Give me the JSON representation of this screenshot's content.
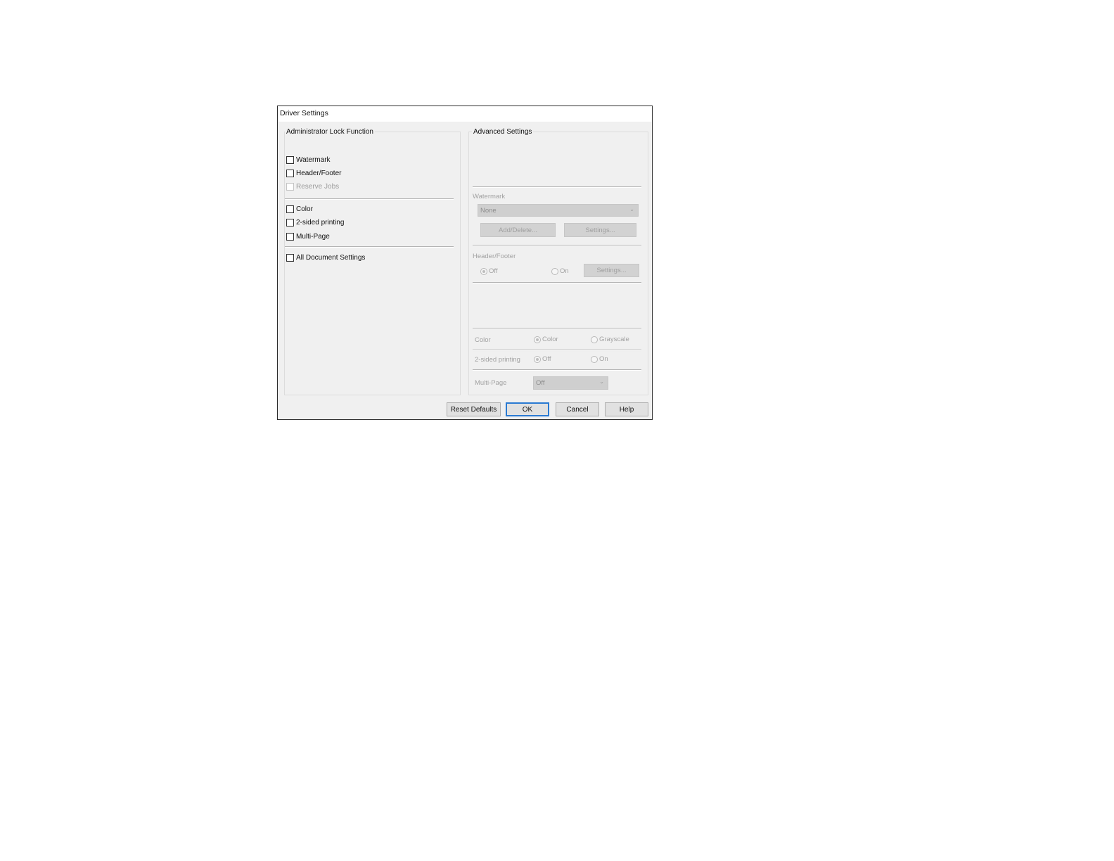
{
  "dialog": {
    "title": "Driver Settings"
  },
  "admin_lock": {
    "title": "Administrator Lock Function",
    "group1": [
      {
        "label": "Watermark",
        "enabled": true
      },
      {
        "label": "Header/Footer",
        "enabled": true
      },
      {
        "label": "Reserve Jobs",
        "enabled": false
      }
    ],
    "group2": [
      {
        "label": "Color",
        "enabled": true
      },
      {
        "label": "2-sided printing",
        "enabled": true
      },
      {
        "label": "Multi-Page",
        "enabled": true
      }
    ],
    "group3": [
      {
        "label": "All Document Settings",
        "enabled": true
      }
    ]
  },
  "advanced": {
    "title": "Advanced Settings",
    "watermark": {
      "label": "Watermark",
      "value": "None",
      "add_delete": "Add/Delete...",
      "settings": "Settings..."
    },
    "header_footer": {
      "label": "Header/Footer",
      "off": "Off",
      "on": "On",
      "settings": "Settings...",
      "selected": "Off"
    },
    "color": {
      "label": "Color",
      "option_color": "Color",
      "option_grayscale": "Grayscale",
      "selected": "Color"
    },
    "two_sided": {
      "label": "2-sided printing",
      "off": "Off",
      "on": "On",
      "selected": "Off"
    },
    "multi_page": {
      "label": "Multi-Page",
      "value": "Off"
    }
  },
  "buttons": {
    "reset": "Reset Defaults",
    "ok": "OK",
    "cancel": "Cancel",
    "help": "Help"
  },
  "icons": {
    "dropdown": "chevron-down-icon"
  }
}
